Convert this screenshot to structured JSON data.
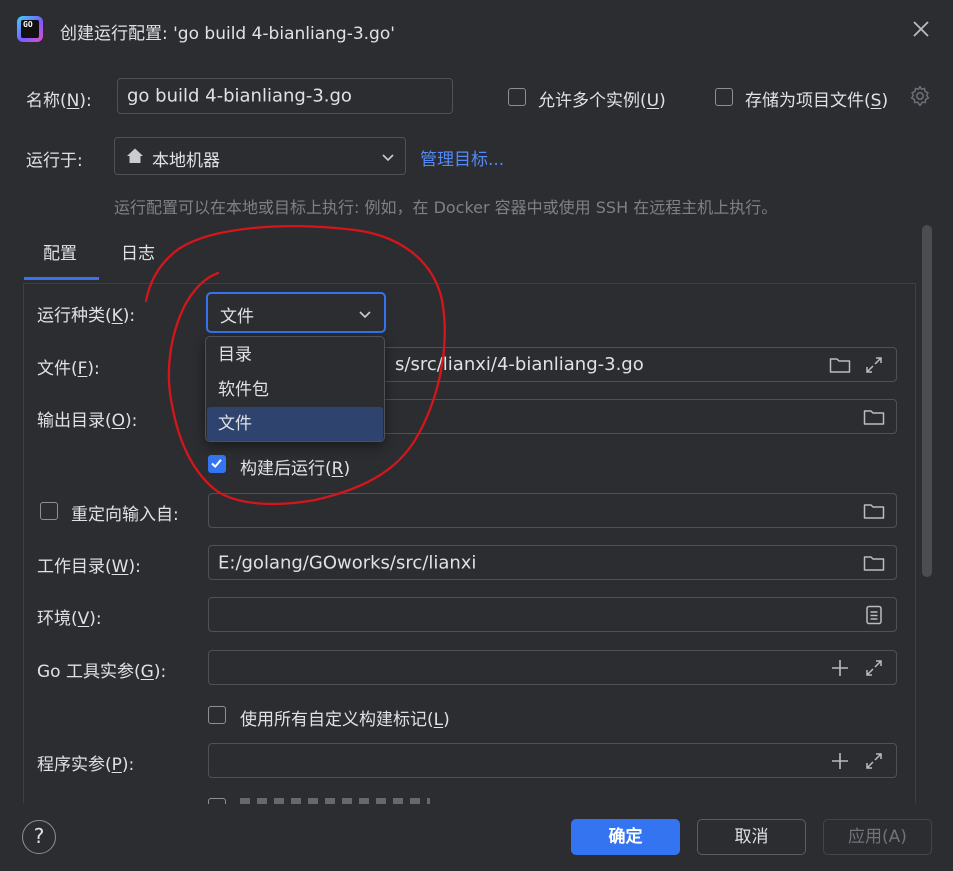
{
  "window": {
    "title": "创建运行配置: 'go build 4-bianliang-3.go'",
    "app_icon_text": "GO"
  },
  "name_row": {
    "label": "名称(",
    "label_key": "N",
    "label_end": "):",
    "value": "go build 4-bianliang-3.go",
    "allow_multiple": {
      "label": "允许多个实例(",
      "key": "U",
      "end": ")",
      "checked": false
    },
    "store_as_project": {
      "label": "存储为项目文件(",
      "key": "S",
      "end": ")",
      "checked": false
    }
  },
  "run_on": {
    "label": "运行于:",
    "target": "本地机器",
    "manage_link": "管理目标...",
    "hint": "运行配置可以在本地或目标上执行: 例如，在 Docker 容器中或使用 SSH 在远程主机上执行。"
  },
  "tabs": [
    {
      "label": "配置",
      "active": true
    },
    {
      "label": "日志",
      "active": false
    }
  ],
  "form": {
    "run_kind": {
      "label": "运行种类(",
      "key": "K",
      "end": "):",
      "value": "文件"
    },
    "run_kind_options": [
      {
        "label": "目录",
        "selected": false
      },
      {
        "label": "软件包",
        "selected": false
      },
      {
        "label": "文件",
        "selected": true
      }
    ],
    "file": {
      "label": "文件(",
      "key": "F",
      "end": "):",
      "value_visible": "s/src/lianxi/4-bianliang-3.go"
    },
    "output_dir": {
      "label": "输出目录(",
      "key": "O",
      "end": "):",
      "value": ""
    },
    "run_after_build": {
      "label": "构建后运行(",
      "key": "R",
      "end": ")",
      "checked": true
    },
    "redirect_input": {
      "label": "重定向输入自:",
      "checked": false,
      "value": ""
    },
    "working_dir": {
      "label": "工作目录(",
      "key": "W",
      "end": "):",
      "value": "E:/golang/GOworks/src/lianxi"
    },
    "environment": {
      "label": "环境(",
      "key": "V",
      "end": "):",
      "value": ""
    },
    "go_tool_args": {
      "label": "Go 工具实参(",
      "key": "G",
      "end": "):",
      "value": ""
    },
    "custom_build_tags": {
      "label": "使用所有自定义构建标记(",
      "key": "L",
      "end": ")",
      "checked": false
    },
    "program_args": {
      "label": "程序实参(",
      "key": "P",
      "end": "):",
      "value": ""
    }
  },
  "footer": {
    "help": "?",
    "ok": "确定",
    "cancel": "取消",
    "apply": "应用(A)"
  },
  "colors": {
    "background": "#2b2d30",
    "accent": "#3574f0",
    "link": "#548af7",
    "annotation": "#d4161c"
  }
}
